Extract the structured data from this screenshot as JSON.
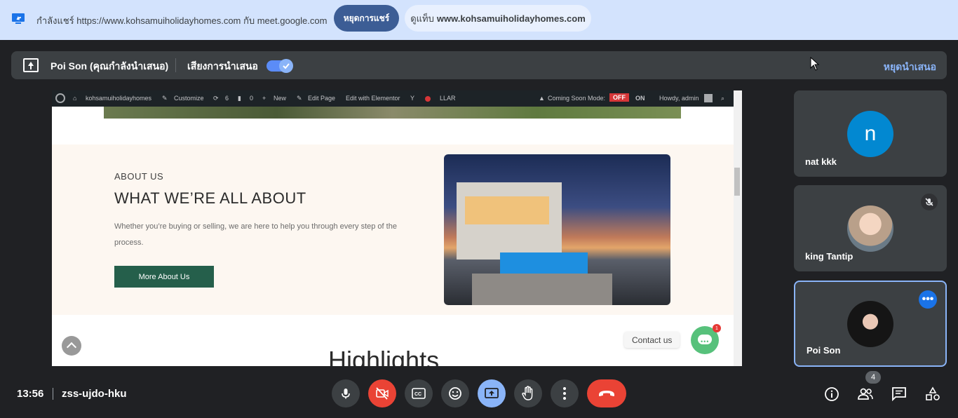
{
  "share_bar": {
    "text": "กำลังแชร์ https://www.kohsamuiholidayhomes.com กับ meet.google.com",
    "stop_label": "หยุดการแชร์",
    "view_prefix": "ดูแท็บ",
    "view_site": "www.kohsamuiholidayhomes.com",
    "accent": "#3c5d95"
  },
  "present_bar": {
    "presenter": "Poi Son (คุณกำลังนำเสนอ)",
    "audio_label": "เสียงการนำเสนอ",
    "audio_on": true,
    "stop_label": "หยุดนำเสนอ"
  },
  "shared_page": {
    "wp_bar": {
      "site": "kohsamuiholidayhomes",
      "customize": "Customize",
      "updates": "6",
      "comments": "0",
      "new": "New",
      "edit": "Edit Page",
      "elementor": "Edit with Elementor",
      "llar": "LLAR",
      "coming_soon": "Coming Soon Mode:",
      "off": "OFF",
      "on": "ON",
      "howdy": "Howdy, admin"
    },
    "about": {
      "eyebrow": "ABOUT US",
      "title": "WHAT WE’RE ALL ABOUT",
      "desc": "Whether you’re buying or selling, we are here to help you through every step of the process.",
      "button": "More About Us"
    },
    "highlights": "Highlights",
    "contact": "Contact us",
    "chat_badge": "1"
  },
  "participants": [
    {
      "name": "nat kkk",
      "initial": "n",
      "muted": false
    },
    {
      "name": "king Tantip",
      "initial": "",
      "muted": true
    },
    {
      "name": "Poi Son",
      "initial": "",
      "muted": false
    }
  ],
  "bottom": {
    "time": "13:56",
    "meeting_code": "zss-ujdo-hku",
    "participant_count": "4"
  }
}
